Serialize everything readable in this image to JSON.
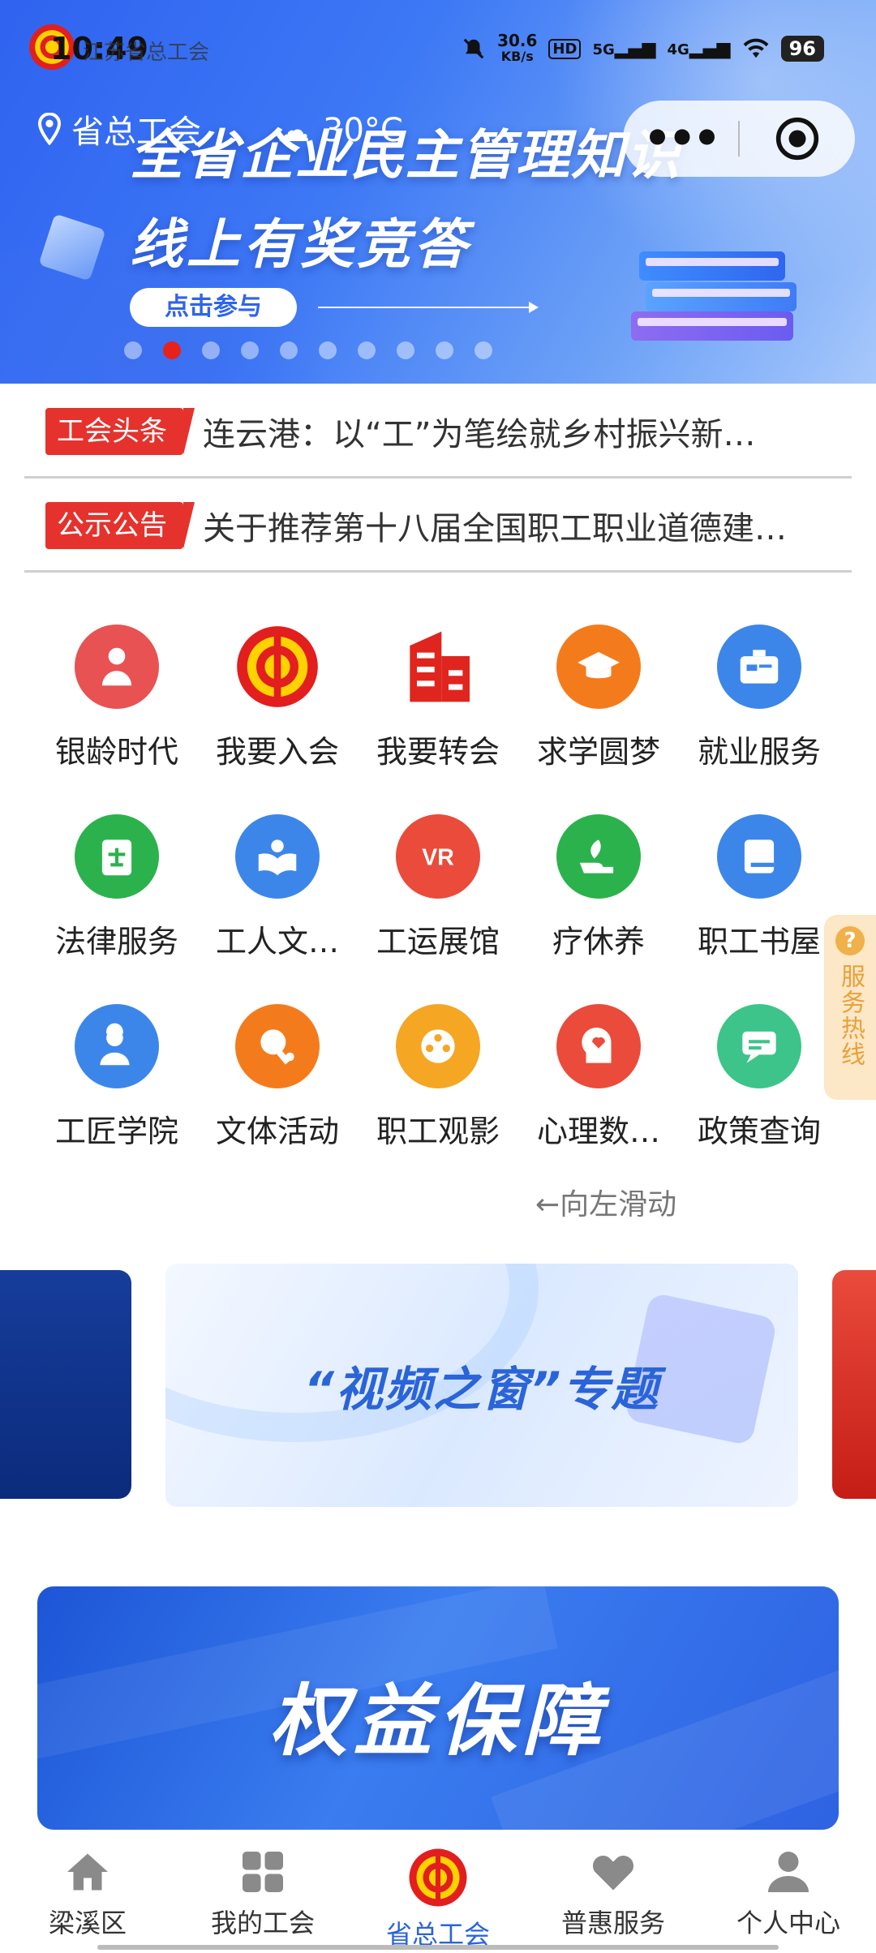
{
  "status_bar": {
    "time": "10:49",
    "app_name": "江苏省总工会",
    "net_speed_value": "30.6",
    "net_speed_unit": "KB/s",
    "hd": "HD",
    "net_5g": "5G",
    "net_4g": "4G",
    "battery": "96"
  },
  "header": {
    "location": "省总工会",
    "weather": "30°C"
  },
  "hero": {
    "title": "全省企业民主管理知识",
    "subtitle": "线上有奖竞答",
    "cta": "点击参与",
    "slide_count": 10,
    "active_slide": 2
  },
  "notices": [
    {
      "tag": "工会头条",
      "text": "连云港：以“工”为笔绘就乡村振兴新…"
    },
    {
      "tag": "公示公告",
      "text": "关于推荐第十八届全国职工职业道德建…"
    }
  ],
  "services": [
    [
      {
        "label": "银龄时代",
        "icon": "elderly-person-icon",
        "color": "#e85252"
      },
      {
        "label": "我要入会",
        "icon": "union-emblem-icon",
        "color": "#e21e1e"
      },
      {
        "label": "我要转会",
        "icon": "building-icon",
        "color": "#e0251e"
      },
      {
        "label": "求学圆梦",
        "icon": "graduation-cap-icon",
        "color": "#f47b1c"
      },
      {
        "label": "就业服务",
        "icon": "briefcase-icon",
        "color": "#3c86ea"
      }
    ],
    [
      {
        "label": "法律服务",
        "icon": "law-book-icon",
        "color": "#2bb24c"
      },
      {
        "label": "工人文…",
        "icon": "open-book-icon",
        "color": "#3c86ea"
      },
      {
        "label": "工运展馆",
        "icon": "vr-icon",
        "color": "#ea4b3a"
      },
      {
        "label": "疗休养",
        "icon": "leaf-hand-icon",
        "color": "#2bb24c"
      },
      {
        "label": "职工书屋",
        "icon": "book-icon",
        "color": "#3c86ea"
      }
    ],
    [
      {
        "label": "工匠学院",
        "icon": "craftsman-icon",
        "color": "#3c86ea"
      },
      {
        "label": "文体活动",
        "icon": "ping-pong-icon",
        "color": "#f47b1c"
      },
      {
        "label": "职工观影",
        "icon": "film-reel-icon",
        "color": "#f5a623"
      },
      {
        "label": "心理数…",
        "icon": "heart-head-icon",
        "color": "#ea4b3a"
      },
      {
        "label": "政策查询",
        "icon": "chat-icon",
        "color": "#3cc48a"
      }
    ]
  ],
  "swipe_hint": "←向左滑动",
  "hotline": {
    "label": "服务热线",
    "icon": "question-icon"
  },
  "carousel": {
    "title": "“视频之窗”专题"
  },
  "rights_banner": {
    "title": "权益保障"
  },
  "tabbar": [
    {
      "label": "梁溪区",
      "icon": "home-icon",
      "active": false
    },
    {
      "label": "我的工会",
      "icon": "grid-icon",
      "active": false
    },
    {
      "label": "省总工会",
      "icon": "union-emblem-icon",
      "active": true
    },
    {
      "label": "普惠服务",
      "icon": "heart-icon",
      "active": false
    },
    {
      "label": "个人中心",
      "icon": "person-icon",
      "active": false
    }
  ]
}
